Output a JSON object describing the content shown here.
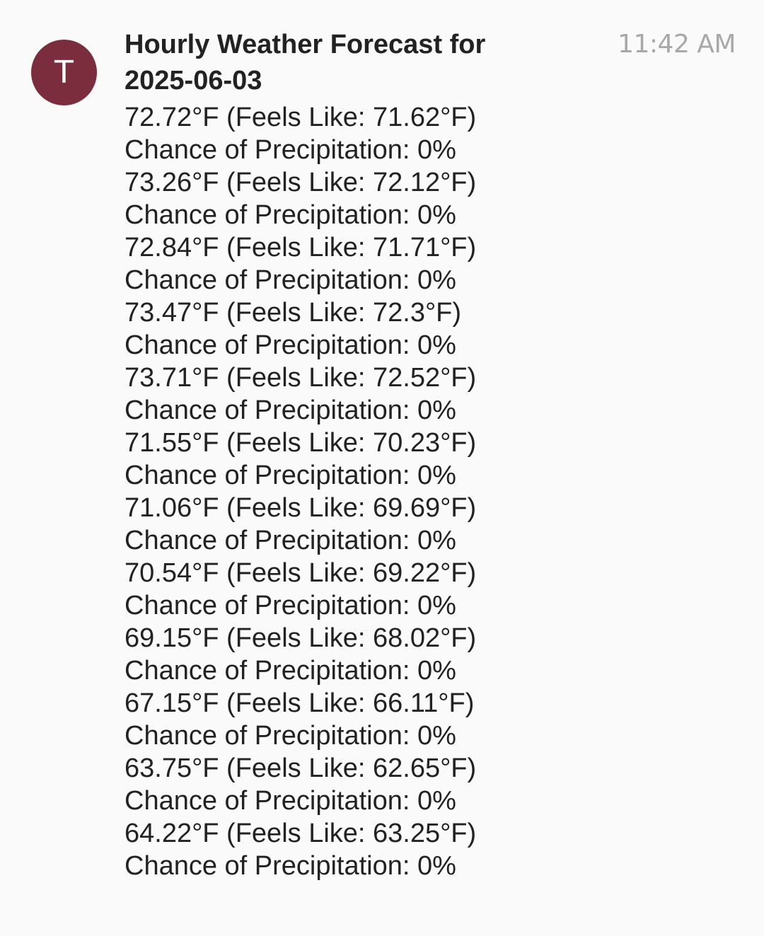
{
  "sender": {
    "avatar_initial": "T",
    "avatar_color": "#7b2d3e"
  },
  "message": {
    "time": "11:42 AM",
    "title_line1": "Hourly Weather Forecast for",
    "title_line2": "2025-06-03",
    "forecast": [
      {
        "temp_line": "72.72°F (Feels Like: 71.62°F)",
        "precip_line": "Chance of Precipitation: 0%"
      },
      {
        "temp_line": "73.26°F (Feels Like: 72.12°F)",
        "precip_line": "Chance of Precipitation: 0%"
      },
      {
        "temp_line": "72.84°F (Feels Like: 71.71°F)",
        "precip_line": "Chance of Precipitation: 0%"
      },
      {
        "temp_line": "73.47°F (Feels Like: 72.3°F)",
        "precip_line": "Chance of Precipitation: 0%"
      },
      {
        "temp_line": "73.71°F (Feels Like: 72.52°F)",
        "precip_line": "Chance of Precipitation: 0%"
      },
      {
        "temp_line": "71.55°F (Feels Like: 70.23°F)",
        "precip_line": "Chance of Precipitation: 0%"
      },
      {
        "temp_line": "71.06°F (Feels Like: 69.69°F)",
        "precip_line": "Chance of Precipitation: 0%"
      },
      {
        "temp_line": "70.54°F (Feels Like: 69.22°F)",
        "precip_line": "Chance of Precipitation: 0%"
      },
      {
        "temp_line": "69.15°F (Feels Like: 68.02°F)",
        "precip_line": "Chance of Precipitation: 0%"
      },
      {
        "temp_line": "67.15°F (Feels Like: 66.11°F)",
        "precip_line": "Chance of Precipitation: 0%"
      },
      {
        "temp_line": "63.75°F (Feels Like: 62.65°F)",
        "precip_line": "Chance of Precipitation: 0%"
      },
      {
        "temp_line": "64.22°F (Feels Like: 63.25°F)",
        "precip_line": "Chance of Precipitation: 0%"
      }
    ]
  }
}
